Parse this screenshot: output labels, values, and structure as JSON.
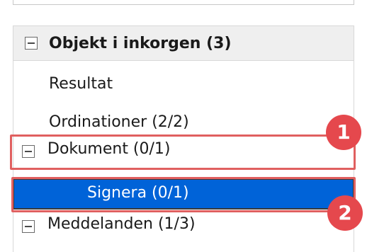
{
  "inbox": {
    "title": "Objekt i inkorgen (3)",
    "items": [
      {
        "label": "Resultat"
      },
      {
        "label": "Ordinationer (2/2)"
      },
      {
        "label": "Dokument (0/1)"
      },
      {
        "label": "Signera (0/1)"
      },
      {
        "label": "Meddelanden (1/3)"
      }
    ]
  },
  "callouts": {
    "first": "1",
    "second": "2"
  },
  "colors": {
    "selection": "#0063d8",
    "callout": "#e5484d",
    "header_bg": "#efefef"
  }
}
